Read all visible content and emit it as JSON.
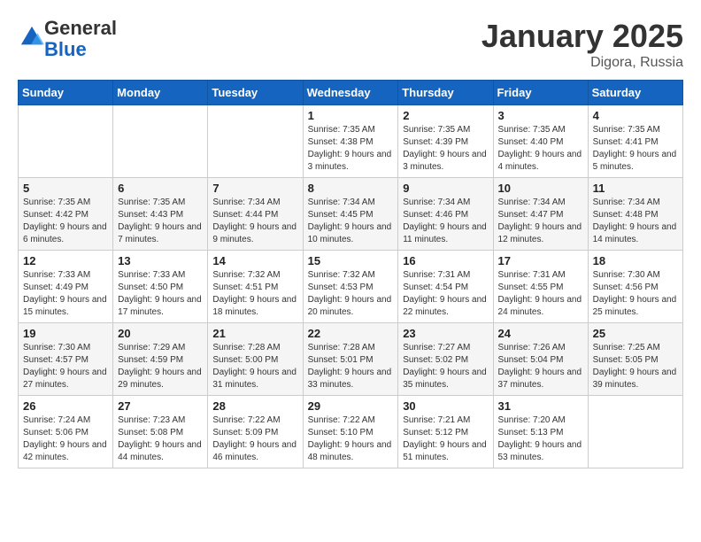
{
  "logo": {
    "general": "General",
    "blue": "Blue"
  },
  "header": {
    "month": "January 2025",
    "location": "Digora, Russia"
  },
  "weekdays": [
    "Sunday",
    "Monday",
    "Tuesday",
    "Wednesday",
    "Thursday",
    "Friday",
    "Saturday"
  ],
  "weeks": [
    [
      {
        "day": "",
        "info": ""
      },
      {
        "day": "",
        "info": ""
      },
      {
        "day": "",
        "info": ""
      },
      {
        "day": "1",
        "info": "Sunrise: 7:35 AM\nSunset: 4:38 PM\nDaylight: 9 hours and 3 minutes."
      },
      {
        "day": "2",
        "info": "Sunrise: 7:35 AM\nSunset: 4:39 PM\nDaylight: 9 hours and 3 minutes."
      },
      {
        "day": "3",
        "info": "Sunrise: 7:35 AM\nSunset: 4:40 PM\nDaylight: 9 hours and 4 minutes."
      },
      {
        "day": "4",
        "info": "Sunrise: 7:35 AM\nSunset: 4:41 PM\nDaylight: 9 hours and 5 minutes."
      }
    ],
    [
      {
        "day": "5",
        "info": "Sunrise: 7:35 AM\nSunset: 4:42 PM\nDaylight: 9 hours and 6 minutes."
      },
      {
        "day": "6",
        "info": "Sunrise: 7:35 AM\nSunset: 4:43 PM\nDaylight: 9 hours and 7 minutes."
      },
      {
        "day": "7",
        "info": "Sunrise: 7:34 AM\nSunset: 4:44 PM\nDaylight: 9 hours and 9 minutes."
      },
      {
        "day": "8",
        "info": "Sunrise: 7:34 AM\nSunset: 4:45 PM\nDaylight: 9 hours and 10 minutes."
      },
      {
        "day": "9",
        "info": "Sunrise: 7:34 AM\nSunset: 4:46 PM\nDaylight: 9 hours and 11 minutes."
      },
      {
        "day": "10",
        "info": "Sunrise: 7:34 AM\nSunset: 4:47 PM\nDaylight: 9 hours and 12 minutes."
      },
      {
        "day": "11",
        "info": "Sunrise: 7:34 AM\nSunset: 4:48 PM\nDaylight: 9 hours and 14 minutes."
      }
    ],
    [
      {
        "day": "12",
        "info": "Sunrise: 7:33 AM\nSunset: 4:49 PM\nDaylight: 9 hours and 15 minutes."
      },
      {
        "day": "13",
        "info": "Sunrise: 7:33 AM\nSunset: 4:50 PM\nDaylight: 9 hours and 17 minutes."
      },
      {
        "day": "14",
        "info": "Sunrise: 7:32 AM\nSunset: 4:51 PM\nDaylight: 9 hours and 18 minutes."
      },
      {
        "day": "15",
        "info": "Sunrise: 7:32 AM\nSunset: 4:53 PM\nDaylight: 9 hours and 20 minutes."
      },
      {
        "day": "16",
        "info": "Sunrise: 7:31 AM\nSunset: 4:54 PM\nDaylight: 9 hours and 22 minutes."
      },
      {
        "day": "17",
        "info": "Sunrise: 7:31 AM\nSunset: 4:55 PM\nDaylight: 9 hours and 24 minutes."
      },
      {
        "day": "18",
        "info": "Sunrise: 7:30 AM\nSunset: 4:56 PM\nDaylight: 9 hours and 25 minutes."
      }
    ],
    [
      {
        "day": "19",
        "info": "Sunrise: 7:30 AM\nSunset: 4:57 PM\nDaylight: 9 hours and 27 minutes."
      },
      {
        "day": "20",
        "info": "Sunrise: 7:29 AM\nSunset: 4:59 PM\nDaylight: 9 hours and 29 minutes."
      },
      {
        "day": "21",
        "info": "Sunrise: 7:28 AM\nSunset: 5:00 PM\nDaylight: 9 hours and 31 minutes."
      },
      {
        "day": "22",
        "info": "Sunrise: 7:28 AM\nSunset: 5:01 PM\nDaylight: 9 hours and 33 minutes."
      },
      {
        "day": "23",
        "info": "Sunrise: 7:27 AM\nSunset: 5:02 PM\nDaylight: 9 hours and 35 minutes."
      },
      {
        "day": "24",
        "info": "Sunrise: 7:26 AM\nSunset: 5:04 PM\nDaylight: 9 hours and 37 minutes."
      },
      {
        "day": "25",
        "info": "Sunrise: 7:25 AM\nSunset: 5:05 PM\nDaylight: 9 hours and 39 minutes."
      }
    ],
    [
      {
        "day": "26",
        "info": "Sunrise: 7:24 AM\nSunset: 5:06 PM\nDaylight: 9 hours and 42 minutes."
      },
      {
        "day": "27",
        "info": "Sunrise: 7:23 AM\nSunset: 5:08 PM\nDaylight: 9 hours and 44 minutes."
      },
      {
        "day": "28",
        "info": "Sunrise: 7:22 AM\nSunset: 5:09 PM\nDaylight: 9 hours and 46 minutes."
      },
      {
        "day": "29",
        "info": "Sunrise: 7:22 AM\nSunset: 5:10 PM\nDaylight: 9 hours and 48 minutes."
      },
      {
        "day": "30",
        "info": "Sunrise: 7:21 AM\nSunset: 5:12 PM\nDaylight: 9 hours and 51 minutes."
      },
      {
        "day": "31",
        "info": "Sunrise: 7:20 AM\nSunset: 5:13 PM\nDaylight: 9 hours and 53 minutes."
      },
      {
        "day": "",
        "info": ""
      }
    ]
  ]
}
